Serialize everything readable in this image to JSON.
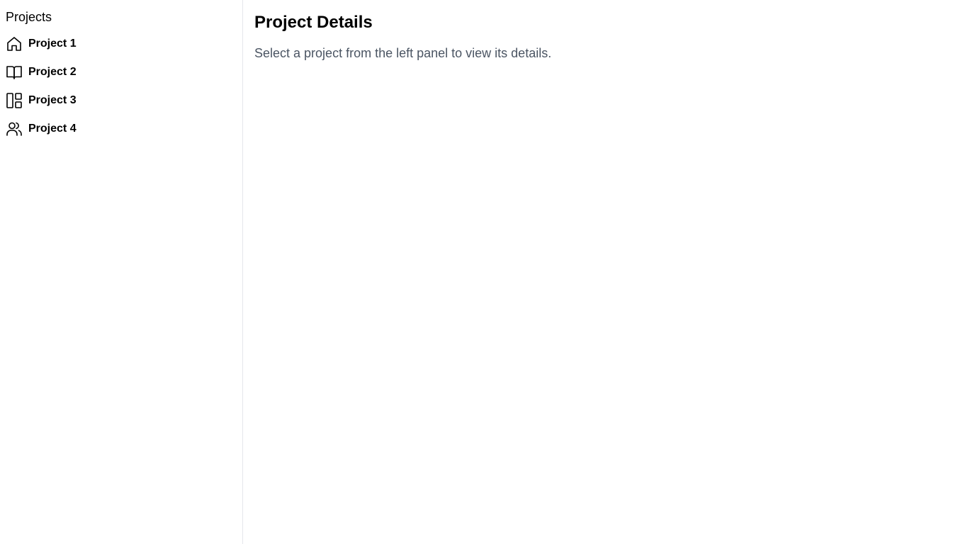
{
  "sidebar": {
    "title": "Projects",
    "items": [
      {
        "label": "Project 1",
        "icon": "home-icon"
      },
      {
        "label": "Project 2",
        "icon": "book-open-icon"
      },
      {
        "label": "Project 3",
        "icon": "layout-dashboard-icon"
      },
      {
        "label": "Project 4",
        "icon": "users-icon"
      }
    ]
  },
  "main": {
    "title": "Project Details",
    "description": "Select a project from the left panel to view its details."
  },
  "colors": {
    "text": "#000000",
    "muted_text": "#4b5563",
    "border": "#e5e7eb",
    "background": "#ffffff"
  }
}
